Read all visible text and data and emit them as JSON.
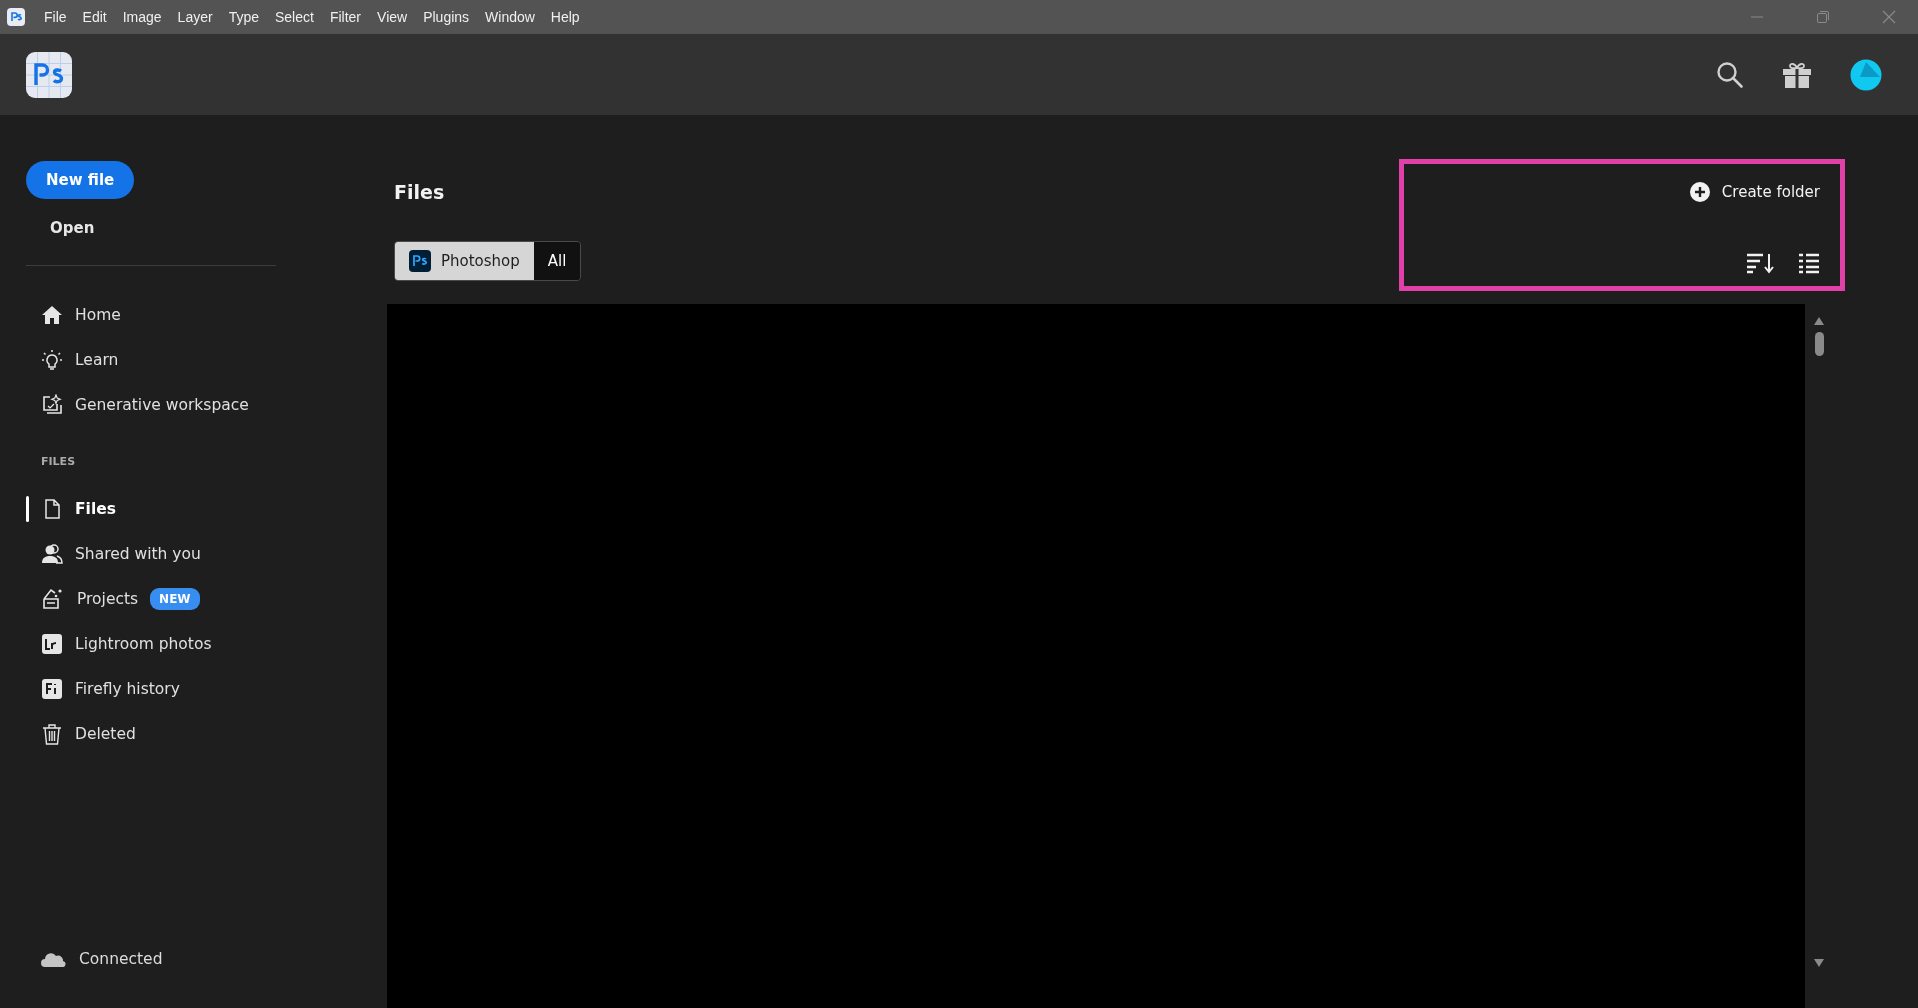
{
  "menu_bar": {
    "items": [
      "File",
      "Edit",
      "Image",
      "Layer",
      "Type",
      "Select",
      "Filter",
      "View",
      "Plugins",
      "Window",
      "Help"
    ]
  },
  "sidebar": {
    "new_file": "New file",
    "open": "Open",
    "nav_items": [
      {
        "label": "Home",
        "selected": false
      },
      {
        "label": "Learn",
        "selected": false
      },
      {
        "label": "Generative workspace",
        "selected": false
      }
    ],
    "files_section": {
      "heading": "FILES",
      "items": [
        {
          "label": "Files",
          "selected": true
        },
        {
          "label": "Shared with you",
          "selected": false
        },
        {
          "label": "Projects",
          "selected": false,
          "badge": "NEW"
        },
        {
          "label": "Lightroom photos",
          "selected": false
        },
        {
          "label": "Firefly history",
          "selected": false
        },
        {
          "label": "Deleted",
          "selected": false
        }
      ]
    },
    "status": "Connected"
  },
  "main": {
    "title": "Files",
    "create_folder": "Create folder",
    "filter": [
      {
        "label": "Photoshop",
        "selected": true
      },
      {
        "label": "All",
        "selected": false
      }
    ]
  }
}
